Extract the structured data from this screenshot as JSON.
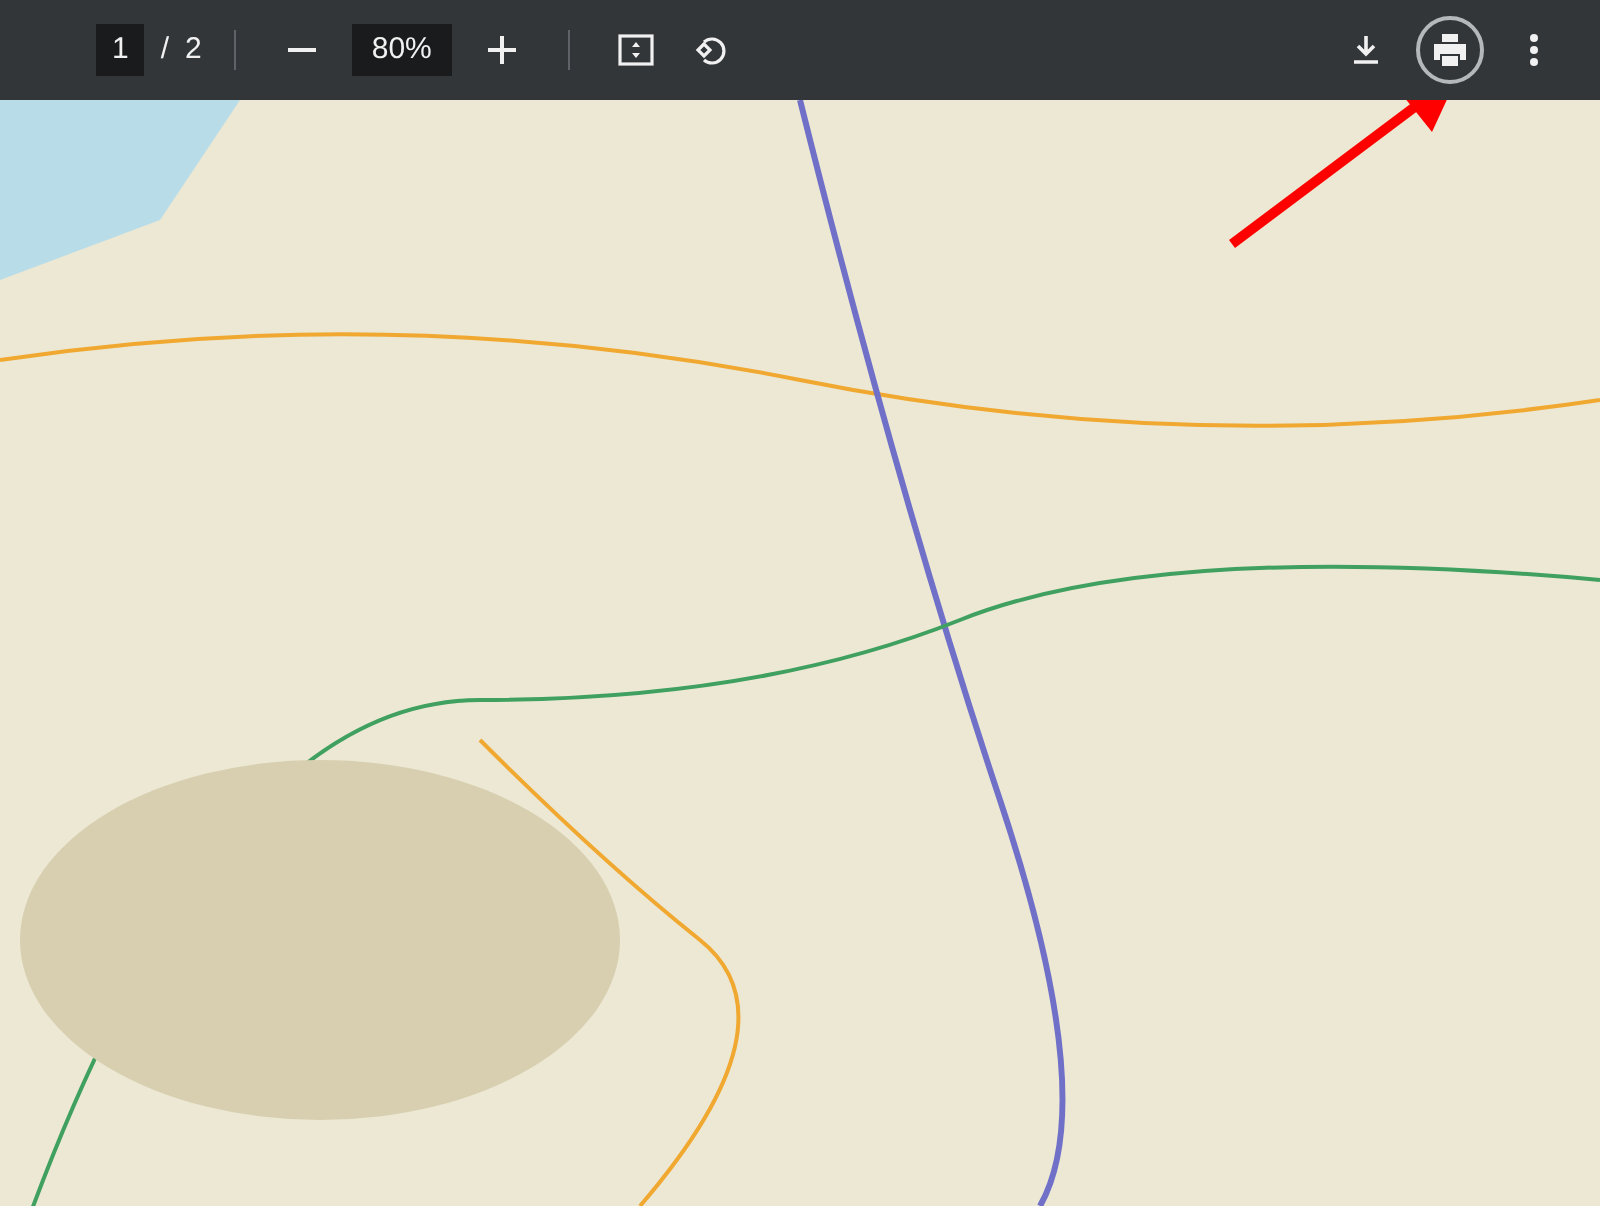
{
  "toolbar": {
    "page_current": "1",
    "page_separator": "/",
    "page_total": "2",
    "zoom": "80%",
    "actions": [
      {
        "kind": "download",
        "highlighted": false
      },
      {
        "kind": "print",
        "highlighted": true
      },
      {
        "kind": "more",
        "highlighted": false
      }
    ]
  },
  "annotation": {
    "kind": "arrow",
    "color": "#ff0000"
  }
}
